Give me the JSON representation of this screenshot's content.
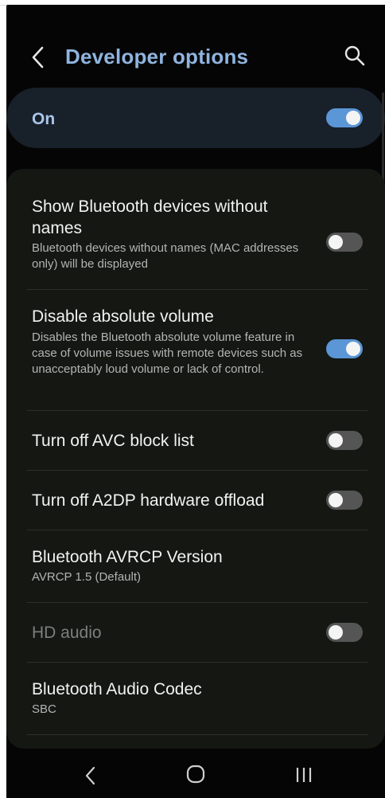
{
  "header": {
    "title": "Developer options",
    "back_icon": "back-arrow-icon",
    "search_icon": "search-icon"
  },
  "master": {
    "label": "On",
    "enabled": true
  },
  "settings": [
    {
      "title": "Show Bluetooth devices without names",
      "subtitle": "Bluetooth devices without names (MAC addresses only) will be displayed",
      "toggle": false
    },
    {
      "title": "Disable absolute volume",
      "subtitle": "Disables the Bluetooth absolute volume feature in case of volume issues with remote devices such as unacceptably loud volume or lack of control.",
      "toggle": true
    },
    {
      "title": "Turn off AVC block list",
      "toggle": false
    },
    {
      "title": "Turn off A2DP hardware offload",
      "toggle": false
    },
    {
      "title": "Bluetooth AVRCP Version",
      "subtitle": "AVRCP 1.5 (Default)"
    },
    {
      "title": "HD audio",
      "toggle": false,
      "disabled": true
    },
    {
      "title": "Bluetooth Audio Codec",
      "subtitle": "SBC"
    }
  ],
  "navbar": {
    "back_icon": "nav-back-icon",
    "home_icon": "nav-home-icon",
    "recent_icon": "nav-recent-apps-icon"
  },
  "colors": {
    "accent": "#5b96d6",
    "title": "#8fb4de",
    "background": "#050505",
    "card": "#141712"
  }
}
